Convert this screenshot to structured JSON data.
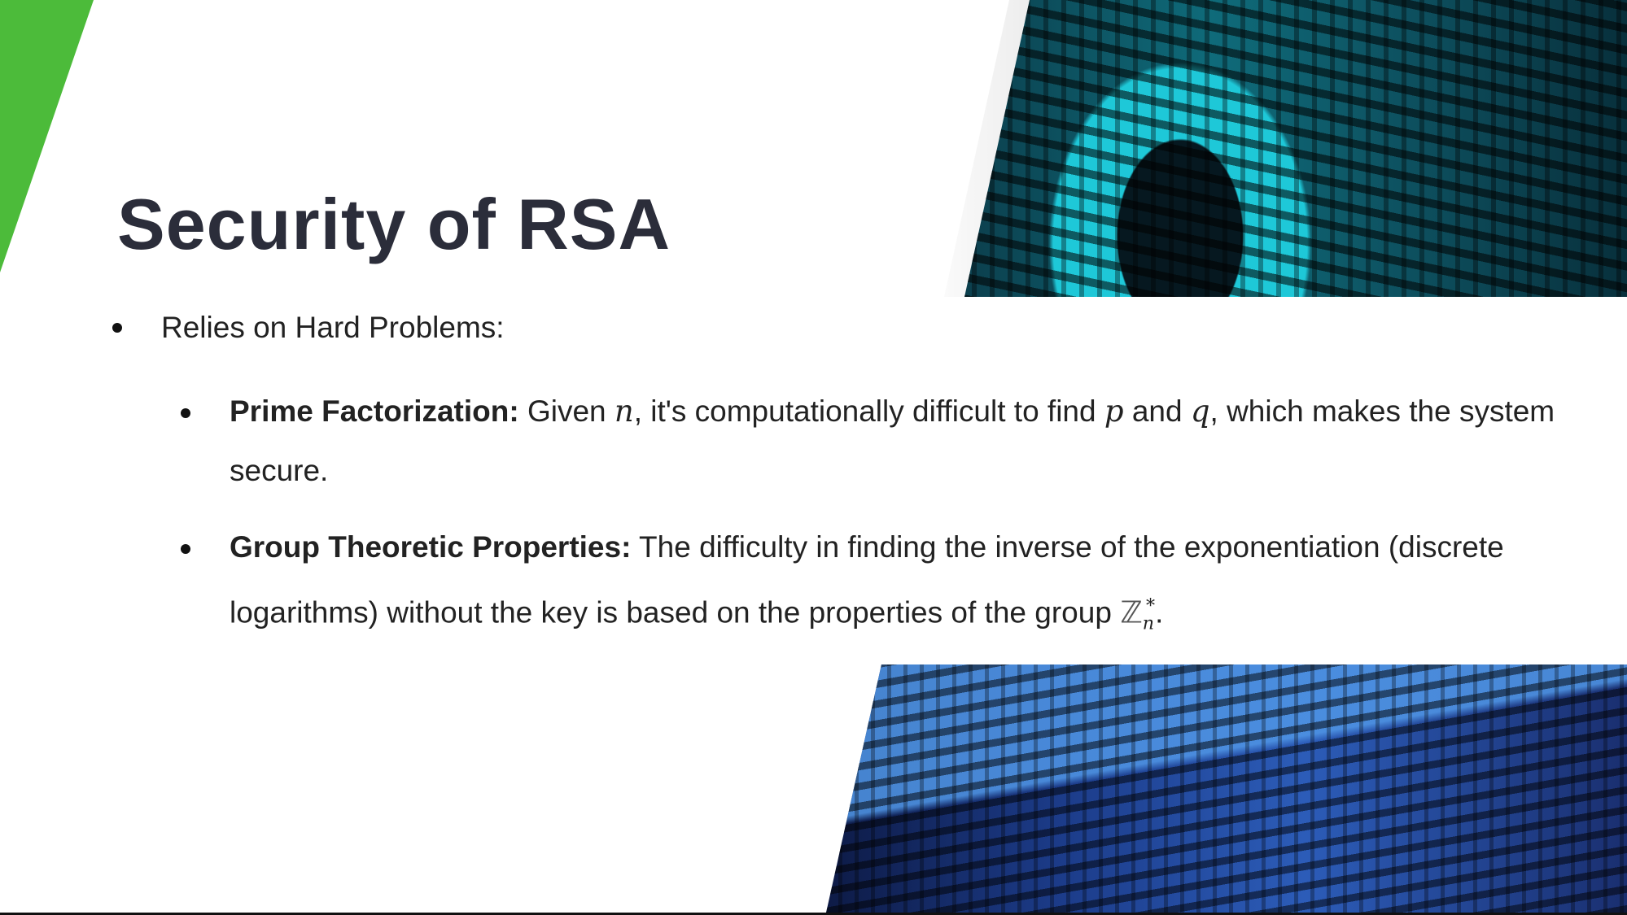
{
  "slide": {
    "title": "Security of RSA",
    "bullets": [
      {
        "text": "Relies on Hard Problems:",
        "children": [
          {
            "label": "Prime Factorization:",
            "parts": [
              "Given ",
              "n",
              ", it's computationally difficult to find ",
              "p",
              " and ",
              "q",
              ", which makes the system secure."
            ]
          },
          {
            "label": "Group Theoretic Properties:",
            "parts": [
              "The difficulty in finding the inverse of the exponentiation (discrete logarithms) without the key is based on the properties of the group ",
              "ℤ",
              "n",
              "*",
              "."
            ]
          }
        ]
      }
    ]
  },
  "colors": {
    "accent_green": "#4cbb3a",
    "title": "#2b2d3a"
  }
}
